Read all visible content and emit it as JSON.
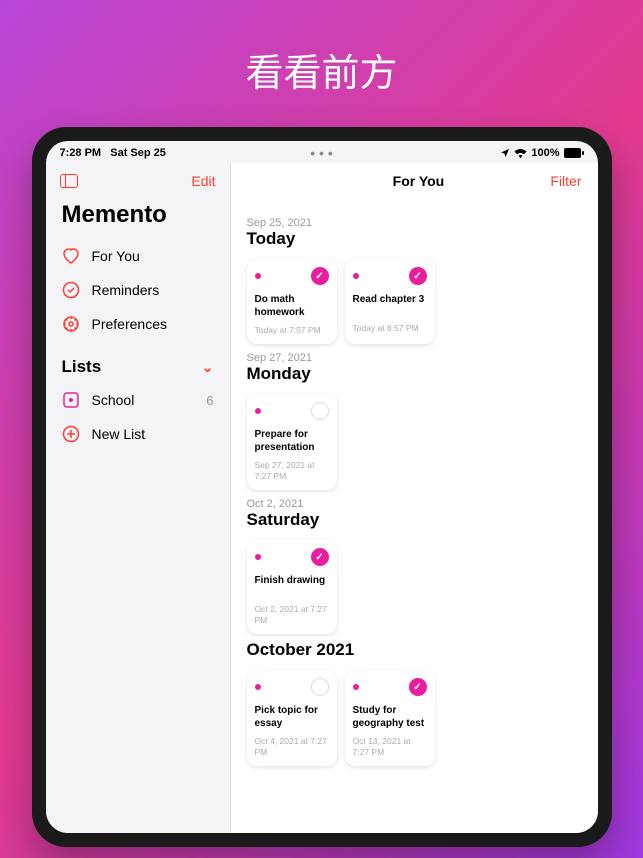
{
  "promo": "看看前方",
  "status": {
    "time": "7:28 PM",
    "date": "Sat Sep 25",
    "battery": "100%"
  },
  "sidebar": {
    "edit": "Edit",
    "appName": "Memento",
    "nav": [
      {
        "label": "For You"
      },
      {
        "label": "Reminders"
      },
      {
        "label": "Preferences"
      }
    ],
    "listsHeader": "Lists",
    "lists": [
      {
        "label": "School",
        "count": "6"
      },
      {
        "label": "New List"
      }
    ]
  },
  "main": {
    "title": "For You",
    "filter": "Filter",
    "sections": [
      {
        "date": "Sep 25, 2021",
        "name": "Today",
        "cards": [
          {
            "title": "Do math homework",
            "sub": "Today at 7:57 PM",
            "done": true
          },
          {
            "title": "Read chapter 3",
            "sub": "Today at 8:57 PM",
            "done": true
          }
        ]
      },
      {
        "date": "Sep 27, 2021",
        "name": "Monday",
        "cards": [
          {
            "title": "Prepare for presentation",
            "sub": "Sep 27, 2021 at 7:27 PM",
            "done": false
          }
        ]
      },
      {
        "date": "Oct 2, 2021",
        "name": "Saturday",
        "cards": [
          {
            "title": "Finish drawing",
            "sub": "Oct 2, 2021 at 7:27 PM",
            "done": true
          }
        ]
      },
      {
        "date": "",
        "name": "October 2021",
        "cards": [
          {
            "title": "Pick topic for essay",
            "sub": "Oct 4, 2021 at 7:27 PM",
            "done": false
          },
          {
            "title": "Study for geography test",
            "sub": "Oct 13, 2021 at 7:27 PM",
            "done": true
          }
        ]
      }
    ]
  }
}
